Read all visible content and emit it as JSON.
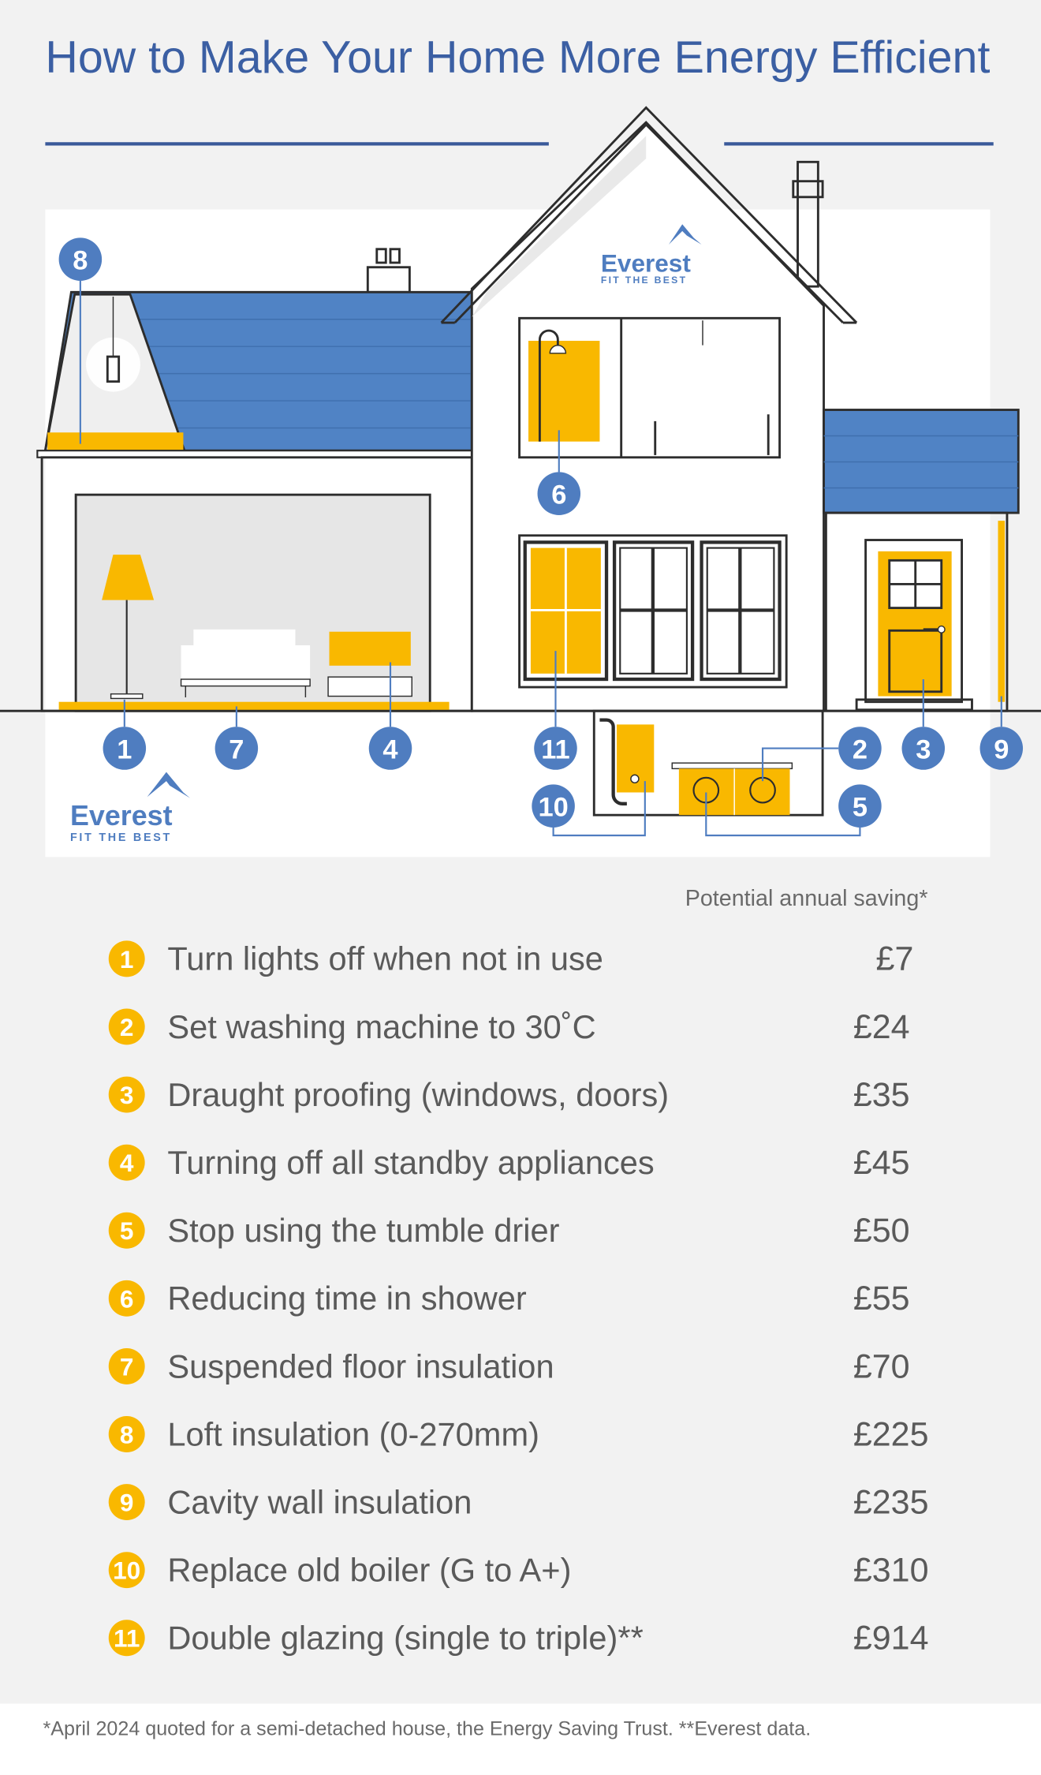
{
  "title": "How to Make Your Home More Energy Efficient",
  "logo": {
    "name": "Everest",
    "tagline": "FIT THE BEST"
  },
  "colors": {
    "accent_blue": "#4f7dc0",
    "roof_blue": "#5083c5",
    "highlight_yellow": "#f9b800",
    "title_blue": "#3b5fa3",
    "background": "#f2f2f2"
  },
  "diagram_badges": [
    "1",
    "2",
    "3",
    "4",
    "5",
    "6",
    "7",
    "8",
    "9",
    "10",
    "11"
  ],
  "savings_header": "Potential annual saving*",
  "items": [
    {
      "num": "1",
      "label": "Turn lights off when not in use",
      "value": "£7"
    },
    {
      "num": "2",
      "label": "Set washing machine to 30˚C",
      "value": "£24"
    },
    {
      "num": "3",
      "label": "Draught proofing (windows, doors)",
      "value": "£35"
    },
    {
      "num": "4",
      "label": "Turning off all standby appliances",
      "value": "£45"
    },
    {
      "num": "5",
      "label": "Stop using the tumble drier",
      "value": "£50"
    },
    {
      "num": "6",
      "label": "Reducing time in shower",
      "value": "£55"
    },
    {
      "num": "7",
      "label": "Suspended floor insulation",
      "value": "£70"
    },
    {
      "num": "8",
      "label": "Loft insulation (0-270mm)",
      "value": "£225"
    },
    {
      "num": "9",
      "label": "Cavity wall insulation",
      "value": "£235"
    },
    {
      "num": "10",
      "label": "Replace old boiler  (G to A+)",
      "value": "£310"
    },
    {
      "num": "11",
      "label": "Double glazing (single to triple)**",
      "value": "£914"
    }
  ],
  "footnote": "*April 2024 quoted for a semi-detached house, the Energy Saving Trust. **Everest data."
}
